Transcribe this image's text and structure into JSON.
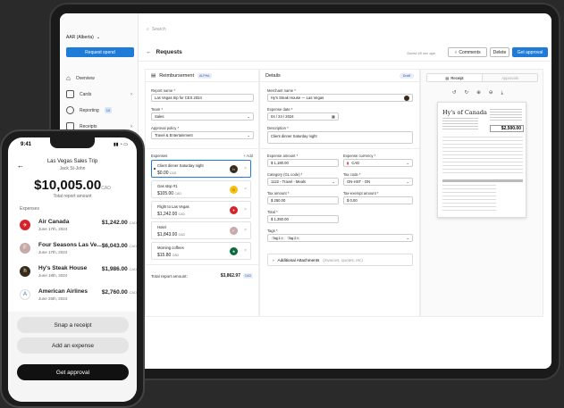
{
  "sidebar": {
    "company": "AAR (Alberta)",
    "request_spend": "Request spend",
    "items": [
      {
        "label": "Overview"
      },
      {
        "label": "Cards"
      },
      {
        "label": "Reporting",
        "badge": "10"
      },
      {
        "label": "Receipts"
      }
    ]
  },
  "search": {
    "placeholder": "Search"
  },
  "header": {
    "title": "Requests",
    "saved": "Saved 49 sec ago",
    "comments": "Comments",
    "delete": "Delete",
    "get_approval": "Get approval"
  },
  "reimbursement": {
    "title": "Reimbursement",
    "badge": "ALPHA",
    "report_name_label": "Report name *",
    "report_name": "Las Vegas trip for CES 2024",
    "team_label": "Team *",
    "team": "Sales",
    "policy_label": "Approval policy *",
    "policy": "Travel & Entertainment",
    "expenses_label": "Expenses",
    "add_label": "+ Add",
    "expenses": [
      {
        "name": "Client dinner Saturday night",
        "amount": "$0.00",
        "currency": "CAD",
        "logo": "h",
        "color": "#3a2a1a"
      },
      {
        "name": "Gas stop #1",
        "amount": "$105.00",
        "currency": "CAD",
        "logo": "S",
        "color": "#f4c20d"
      },
      {
        "name": "Flight to Las Vegas",
        "amount": "$1,242.00",
        "currency": "CAD",
        "logo": "✈",
        "color": "#d3242c"
      },
      {
        "name": "Hotel",
        "amount": "$1,843.00",
        "currency": "CAD",
        "logo": "F",
        "color": "#c7a9a9"
      },
      {
        "name": "Morning coffees",
        "amount": "$15.80",
        "currency": "CAD",
        "logo": "★",
        "color": "#0b6b3f"
      }
    ],
    "total_label": "Total report amount:",
    "total": "$3,862.97",
    "total_currency": "CAD"
  },
  "details": {
    "title": "Details",
    "status": "Draft",
    "merchant_label": "Merchant name *",
    "merchant": "Hy's Steak House — Las Vegas",
    "date_label": "Expense date *",
    "date": "04 / 24 / 2024",
    "desc_label": "Description *",
    "desc": "Client dinner Saturday night",
    "amount_label": "Expense amount *",
    "amount": "$ 1,180.00",
    "currency_label": "Expense currency *",
    "currency": "CAD",
    "category_label": "Category (GL code) *",
    "category": "1122 - Travel - Meals",
    "tax_code_label": "Tax code *",
    "tax_code": "ON-HST - ON",
    "tax_label": "Tax amount *",
    "tax": "$ 250.00",
    "tax_exempt_label": "Tax-exempt amount *",
    "tax_exempt": "$ 0.00",
    "total_label": "Total *",
    "total": "$ 1,350.00",
    "tags_label": "Tags *",
    "tags": [
      "Tag 1 ×",
      "Tag 2 ×"
    ],
    "attachments": "Additional Attachments",
    "attachments_hint": "(invoices, quotes, etc)"
  },
  "receipt_panel": {
    "tab_receipt": "Receipt",
    "tab_approvals": "Approvals",
    "brand": "Hy's of Canada",
    "total": "$2,500.00"
  },
  "phone": {
    "time": "9:41",
    "trip": "Las Vegas Sales Trip",
    "person": "Jack St-John",
    "total": "$10,005.00",
    "total_currency": "CAD",
    "total_label": "Total report amount",
    "expenses_label": "Expenses",
    "items": [
      {
        "name": "Air Canada",
        "date": "June 17th, 2024",
        "amount": "$1,242.00",
        "currency": "CAD",
        "color": "#d3242c",
        "logo": "✈"
      },
      {
        "name": "Four Seasons Las Ve...",
        "date": "June 17th, 2024",
        "amount": "$6,043.00",
        "currency": "CAD",
        "color": "#c7a9a9",
        "logo": "F"
      },
      {
        "name": "Hy's Steak House",
        "date": "June 18th, 2024",
        "amount": "$1,986.00",
        "currency": "CAD",
        "color": "#3a2a1a",
        "logo": "h"
      },
      {
        "name": "American Airlines",
        "date": "June 25th, 2024",
        "amount": "$2,760.00",
        "currency": "CAD",
        "color": "#2b6cb0",
        "logo": "A"
      }
    ],
    "snap": "Snap a receipt",
    "add": "Add an expense",
    "approval": "Get approval"
  }
}
